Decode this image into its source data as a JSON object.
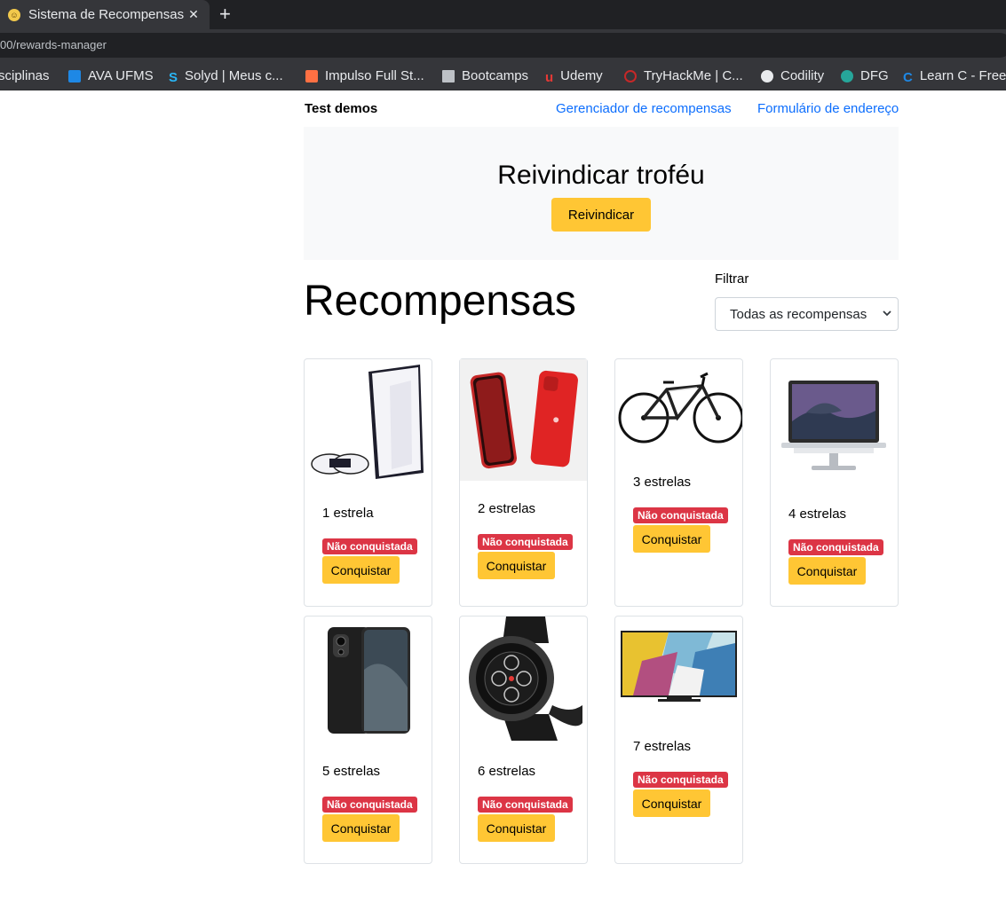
{
  "browser": {
    "tab_title": "Sistema de Recompensas",
    "tab_close": "✕",
    "new_tab": "+",
    "url": "00/rewards-manager",
    "bookmarks": [
      {
        "label": "sciplinas",
        "icon": "none"
      },
      {
        "label": "AVA UFMS",
        "icon": "ava-icon"
      },
      {
        "label": "Solyd | Meus c...",
        "icon": "solyd-icon"
      },
      {
        "label": "Impulso Full St...",
        "icon": "impulso-icon"
      },
      {
        "label": "Bootcamps",
        "icon": "folder-icon"
      },
      {
        "label": "Udemy",
        "icon": "udemy-icon"
      },
      {
        "label": "TryHackMe | C...",
        "icon": "tryhackme-icon"
      },
      {
        "label": "Codility",
        "icon": "codility-icon"
      },
      {
        "label": "DFG",
        "icon": "dfg-icon"
      },
      {
        "label": "Learn C - Free",
        "icon": "learnc-icon"
      }
    ]
  },
  "nav": {
    "brand": "Test demos",
    "links": [
      "Gerenciador de recompensas",
      "Formulário de endereço"
    ]
  },
  "hero": {
    "title": "Reivindicar troféu",
    "button": "Reivindicar"
  },
  "main": {
    "title": "Recompensas",
    "filter_label": "Filtrar",
    "filter_value": "Todas as recompensas"
  },
  "rewards": [
    {
      "stars": "1 estrela",
      "status": "Não conquistada",
      "action": "Conquistar",
      "image": "playstation-5"
    },
    {
      "stars": "2 estrelas",
      "status": "Não conquistada",
      "action": "Conquistar",
      "image": "iphone-red"
    },
    {
      "stars": "3 estrelas",
      "status": "Não conquistada",
      "action": "Conquistar",
      "image": "bicycle"
    },
    {
      "stars": "4 estrelas",
      "status": "Não conquistada",
      "action": "Conquistar",
      "image": "macbook"
    },
    {
      "stars": "5 estrelas",
      "status": "Não conquistada",
      "action": "Conquistar",
      "image": "xiaomi-phone"
    },
    {
      "stars": "6 estrelas",
      "status": "Não conquistada",
      "action": "Conquistar",
      "image": "garmin-watch"
    },
    {
      "stars": "7 estrelas",
      "status": "Não conquistada",
      "action": "Conquistar",
      "image": "qled-tv"
    }
  ],
  "colors": {
    "primary_link": "#0d6efd",
    "warning_button": "#ffc634",
    "danger_badge": "#dc3545",
    "hero_bg": "#f8f9fa"
  }
}
